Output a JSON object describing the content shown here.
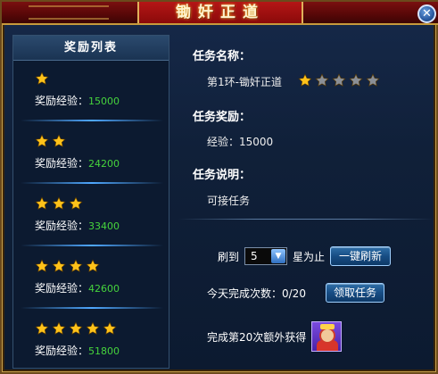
{
  "window": {
    "title": "锄奸正道",
    "close_glyph": "✕"
  },
  "reward_list": {
    "header": "奖励列表",
    "items": [
      {
        "stars": 1,
        "label": "奖励经验：",
        "value": "15000"
      },
      {
        "stars": 2,
        "label": "奖励经验：",
        "value": "24200"
      },
      {
        "stars": 3,
        "label": "奖励经验：",
        "value": "33400"
      },
      {
        "stars": 4,
        "label": "奖励经验：",
        "value": "42600"
      },
      {
        "stars": 5,
        "label": "奖励经验：",
        "value": "51800"
      }
    ]
  },
  "task": {
    "name_title": "任务名称：",
    "name": "第1环-锄奸正道",
    "rating": 1,
    "rating_max": 5,
    "reward_title": "任务奖励：",
    "reward": "经验：15000",
    "desc_title": "任务说明：",
    "desc": "可接任务"
  },
  "refresh": {
    "prefix": "刷到",
    "selected": "5",
    "suffix": "星为止",
    "button": "一键刷新"
  },
  "daily": {
    "label": "今天完成次数：0/20",
    "button": "领取任务"
  },
  "bonus": {
    "label": "完成第20次额外获得",
    "item_icon": "hero-portrait-icon"
  },
  "colors": {
    "star_gold": "#ffc21a",
    "star_gray": "#8a8f96",
    "exp_value": "#46d43c"
  }
}
